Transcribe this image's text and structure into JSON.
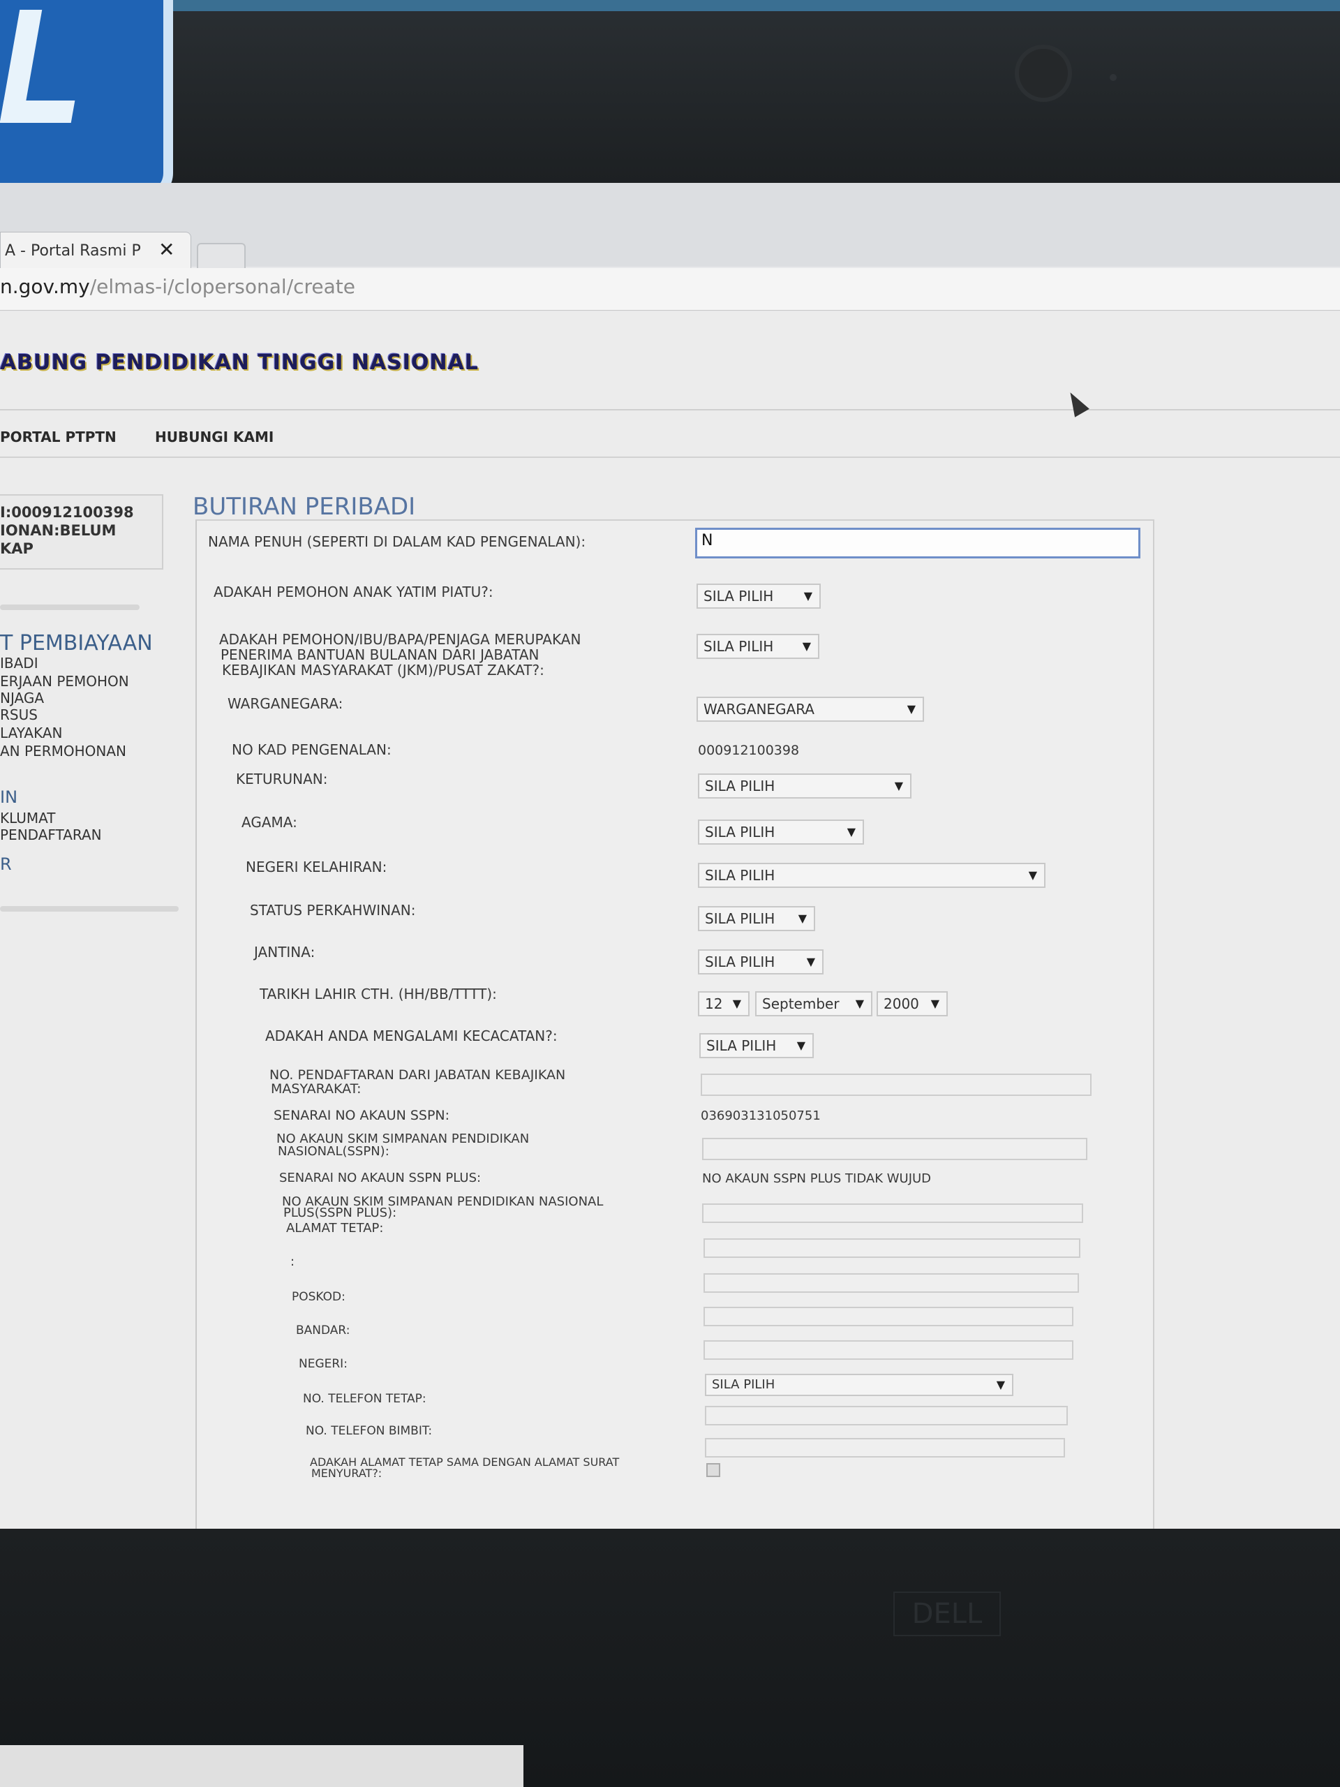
{
  "browser": {
    "tab_title": "A - Portal Rasmi P",
    "tab_close": "✕",
    "url_host": "n.gov.my",
    "url_path": "/elmas-i/clopersonal/create"
  },
  "site": {
    "banner_title": "ABUNG PENDIDIKAN TINGGI NASIONAL",
    "nav": [
      "PORTAL PTPTN",
      "HUBUNGI KAMI"
    ]
  },
  "sidebar": {
    "id_line": "I:000912100398",
    "status_line": "IONAN:BELUM",
    "status_line2": "KAP",
    "heading": "T PEMBIAYAAN",
    "links": [
      "IBADI",
      "ERJAAN PEMOHON",
      "NJAGA",
      "RSUS",
      "LAYAKAN",
      "AN PERMOHONAN"
    ],
    "heading2": "IN",
    "links2": [
      "KLUMAT",
      "PENDAFTARAN"
    ],
    "heading3": "R"
  },
  "form": {
    "section_title": "BUTIRAN PERIBADI",
    "nama_label": "NAMA PENUH (SEPERTI DI DALAM KAD PENGENALAN):",
    "nama_value": "N",
    "yatim_label": "ADAKAH PEMOHON ANAK YATIM PIATU?:",
    "yatim_value": "SILA PILIH",
    "bantuan_label_1": "ADAKAH PEMOHON/IBU/BAPA/PENJAGA MERUPAKAN",
    "bantuan_label_2": "PENERIMA BANTUAN BULANAN DARI JABATAN",
    "bantuan_label_3": "KEBAJIKAN MASYARAKAT (JKM)/PUSAT ZAKAT?:",
    "bantuan_value": "SILA PILIH",
    "warganegara_label": "WARGANEGARA:",
    "warganegara_value": "WARGANEGARA",
    "nokp_label": "NO KAD PENGENALAN:",
    "nokp_value": "000912100398",
    "keturunan_label": "KETURUNAN:",
    "keturunan_value": "SILA PILIH",
    "agama_label": "AGAMA:",
    "agama_value": "SILA PILIH",
    "negeri_lahir_label": "NEGERI KELAHIRAN:",
    "negeri_lahir_value": "SILA PILIH",
    "kahwin_label": "STATUS PERKAHWINAN:",
    "kahwin_value": "SILA PILIH",
    "jantina_label": "JANTINA:",
    "jantina_value": "SILA PILIH",
    "lahir_label": "TARIKH LAHIR CTH. (HH/BB/TTTT):",
    "lahir_day": "12",
    "lahir_month": "September",
    "lahir_year": "2000",
    "kecacatan_label": "ADAKAH ANDA MENGALAMI KECACATAN?:",
    "kecacatan_value": "SILA PILIH",
    "jkm_label_1": "NO. PENDAFTARAN DARI JABATAN KEBAJIKAN",
    "jkm_label_2": "MASYARAKAT:",
    "sspn_list_label": "SENARAI NO AKAUN SSPN:",
    "sspn_list_value": "036903131050751",
    "sspn_label_1": "NO AKAUN SKIM SIMPANAN PENDIDIKAN",
    "sspn_label_2": "NASIONAL(SSPN):",
    "sspnplus_list_label": "SENARAI NO AKAUN SSPN PLUS:",
    "sspnplus_list_value": "NO AKAUN SSPN PLUS TIDAK WUJUD",
    "sspnplus_label_1": "NO AKAUN SKIM SIMPANAN PENDIDIKAN NASIONAL",
    "sspnplus_label_2": "PLUS(SSPN PLUS):",
    "alamat_label": "ALAMAT TETAP:",
    "alamat2_label": ":",
    "poskod_label": "POSKOD:",
    "bandar_label": "BANDAR:",
    "negeri_label": "NEGERI:",
    "negeri_value": "SILA PILIH",
    "tel_tetap_label": "NO. TELEFON TETAP:",
    "tel_bimbit_label": "NO. TELEFON BIMBIT:",
    "sama_label_1": "ADAKAH ALAMAT TETAP SAMA DENGAN ALAMAT SURAT",
    "sama_label_2": "MENYURAT?:"
  },
  "device": {
    "chin_logo": "DELL"
  },
  "icons": {
    "dropdown": "▼"
  }
}
